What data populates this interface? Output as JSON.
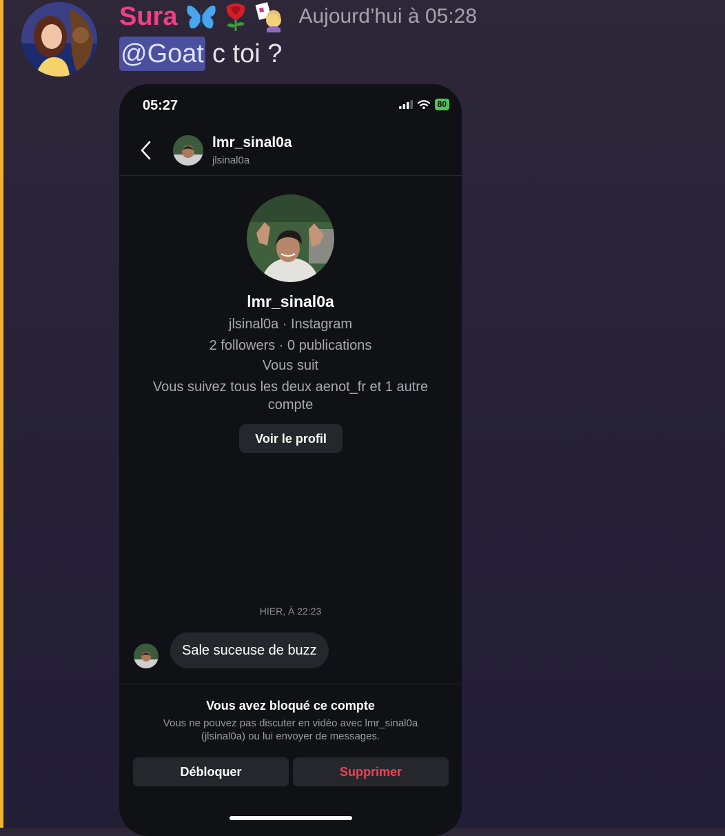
{
  "message": {
    "author": "Sura",
    "timestamp": "Aujourd’hui à 05:28",
    "mention": "@Goat",
    "text": "c toi ?",
    "author_emojis": [
      "butterfly-emoji",
      "rose-emoji",
      "sticker-emoji"
    ]
  },
  "phone": {
    "status_time": "05:27",
    "battery": "80",
    "header": {
      "name": "lmr_sinal0a",
      "handle": "jlsinal0a"
    },
    "profile": {
      "name": "lmr_sinal0a",
      "handle_platform": "jlsinal0a · Instagram",
      "stats": "2 followers · 0 publications",
      "follows_you": "Vous suit",
      "mutual": "Vous suivez tous les deux aenot_fr et 1 autre compte",
      "view_profile": "Voir le profil"
    },
    "date_separator": "HIER, À 22:23",
    "incoming_message": "Sale suceuse de buzz",
    "blocked": {
      "title": "Vous avez bloqué ce compte",
      "description": "Vous ne pouvez pas discuter en vidéo avec lmr_sinal0a (jlsinal0a) ou lui envoyer de messages.",
      "unblock": "Débloquer",
      "delete": "Supprimer"
    }
  },
  "colors": {
    "author": "#ef3f86",
    "mention_bg": "#4a4f9e",
    "accent_bar": "#f0b232",
    "delete": "#ee4256",
    "battery": "#53c25a"
  }
}
